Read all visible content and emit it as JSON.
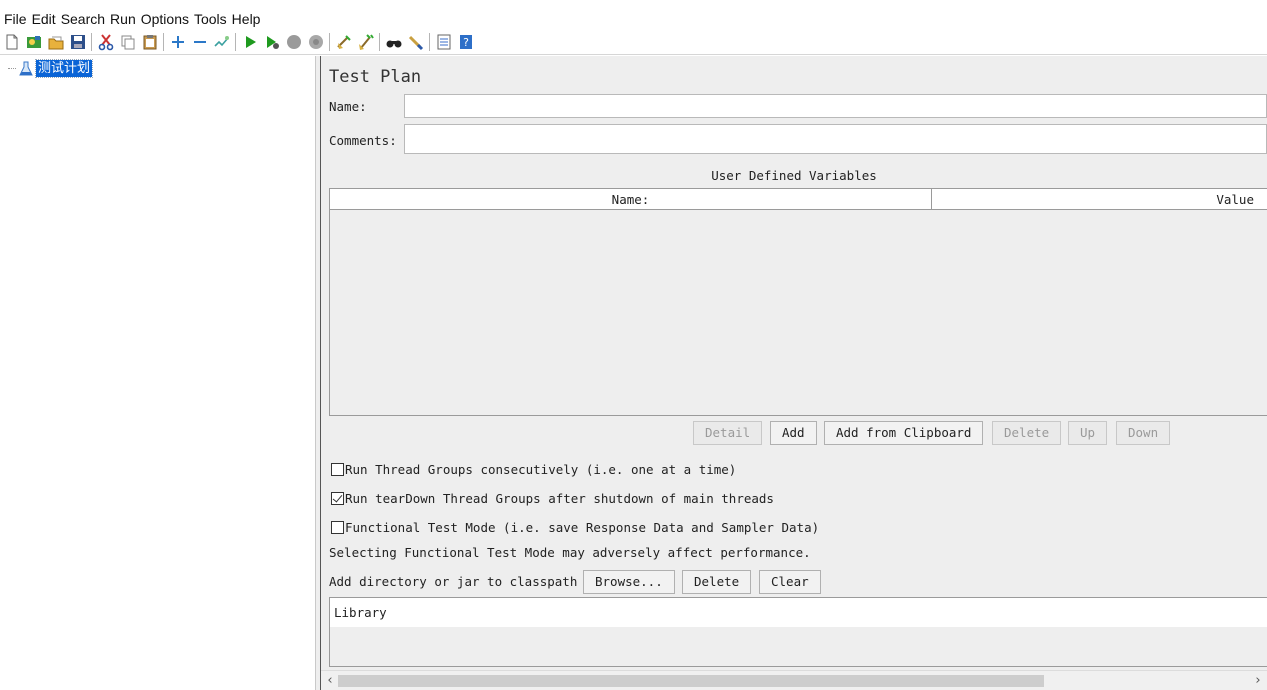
{
  "menu": [
    "File",
    "Edit",
    "Search",
    "Run",
    "Options",
    "Tools",
    "Help"
  ],
  "toolbar_icons": [
    "new-icon",
    "templates-icon",
    "open-icon",
    "save-icon",
    "cut-icon",
    "copy-icon",
    "paste-icon",
    "expand-icon",
    "collapse-icon",
    "toggle-icon",
    "start-icon",
    "start-no-pause-icon",
    "stop-icon",
    "shutdown-icon",
    "clear-icon",
    "clear-all-icon",
    "search-icon",
    "reset-search-icon",
    "function-helper-icon",
    "help-icon"
  ],
  "tree": {
    "root_label": "测试计划"
  },
  "panel": {
    "title": "Test Plan",
    "name_label": "Name:",
    "name_value": "",
    "comments_label": "Comments:",
    "comments_value": "",
    "udv_title": "User Defined Variables",
    "table": {
      "col_name": "Name:",
      "col_value": "Value",
      "rows": []
    },
    "buttons": {
      "detail": "Detail",
      "add": "Add",
      "add_from_clipboard": "Add from Clipboard",
      "delete": "Delete",
      "up": "Up",
      "down": "Down"
    },
    "options": {
      "serialize": {
        "label": "Run Thread Groups consecutively (i.e. one at a time)",
        "checked": false
      },
      "teardown": {
        "label": "Run tearDown Thread Groups after shutdown of main threads",
        "checked": true
      },
      "functional": {
        "label": "Functional Test Mode (i.e. save Response Data and Sampler Data)",
        "checked": false
      }
    },
    "functional_note": "Selecting Functional Test Mode may adversely affect performance.",
    "classpath_label": "Add directory or jar to classpath",
    "classpath_buttons": {
      "browse": "Browse...",
      "delete": "Delete",
      "clear": "Clear"
    },
    "library_header": "Library"
  },
  "colors": {
    "selection": "#0a64d6",
    "panel_bg": "#eeeeee"
  }
}
